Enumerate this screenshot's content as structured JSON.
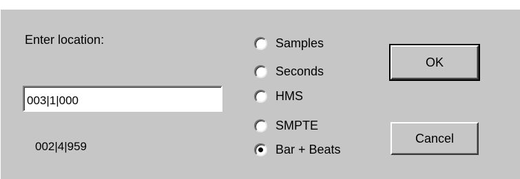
{
  "dialog": {
    "location_label": "Enter location:",
    "location_value": "003|1|000",
    "current_location": "002|4|959"
  },
  "time_format": {
    "options": [
      {
        "label": "Samples",
        "checked": false
      },
      {
        "label": "Seconds",
        "checked": false
      },
      {
        "label": "HMS",
        "checked": false
      },
      {
        "label": "SMPTE",
        "checked": false
      },
      {
        "label": "Bar + Beats",
        "checked": true
      }
    ]
  },
  "buttons": {
    "ok_label": "OK",
    "cancel_label": "Cancel"
  },
  "colors": {
    "dialog_background": "#c6c6c6",
    "input_background": "#ffffff"
  }
}
